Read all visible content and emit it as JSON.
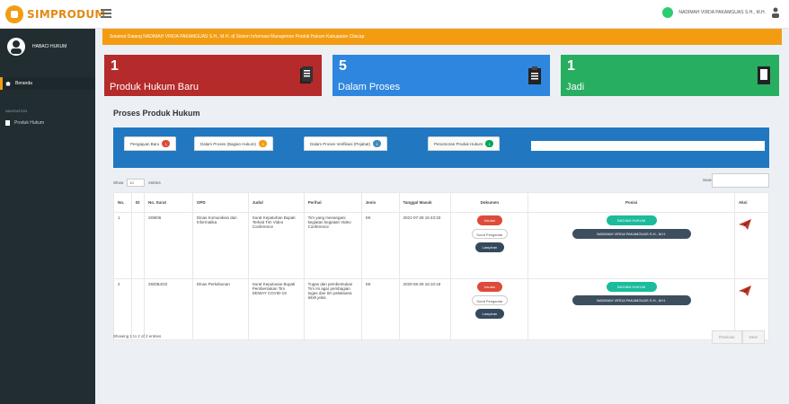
{
  "app": {
    "logo_text": "SIMPRODUM"
  },
  "header": {
    "user_name": "NADIMAH VIRDA PAKAMGUAS S.H., M.H."
  },
  "sidebar": {
    "user_label": "HABACI HUKUM",
    "items": [
      {
        "label": "Beranda",
        "active": true
      },
      {
        "label": "Produk Hukum",
        "active": false
      }
    ],
    "section_header": "NAVIGATION"
  },
  "alert": {
    "text": "Selamat Datang NADIMAH VIRDA PAKAMGUAS S.H., M.H. di Sistem Informasi Manajemen Produk Hukum Kabupaten Cilacap"
  },
  "stats": [
    {
      "count": "1",
      "label": "Produk Hukum Baru",
      "color": "#b52a2a"
    },
    {
      "count": "5",
      "label": "Dalam Proses",
      "color": "#2e86de"
    },
    {
      "count": "1",
      "label": "Jadi",
      "color": "#27ae60"
    }
  ],
  "panel": {
    "title": "Proses Produk Hukum"
  },
  "tabs": [
    {
      "label": "Pengajuan Baru",
      "badge": "1",
      "color": "red"
    },
    {
      "label": "Dalam Proses (Bagian Hukum)",
      "badge": "3",
      "color": "orange"
    },
    {
      "label": "Dalam Proses Verifikasi (Pejabat)",
      "badge": "1",
      "color": "blue"
    },
    {
      "label": "Penomoran Produk Hukum",
      "badge": "1",
      "color": "green"
    }
  ],
  "table_controls": {
    "show_label": "Show",
    "entries_value": "10",
    "entries_label": "entries",
    "search_label": "Search:"
  },
  "table": {
    "headers": [
      "No.",
      "ID",
      "No. Surat",
      "OPD",
      "Judul",
      "Perihal",
      "Jenis",
      "Tanggal Masuk",
      "Dokumen",
      "Posisi",
      "Aksi"
    ],
    "rows": [
      {
        "no": "1",
        "id": "",
        "no_surat": "S08/06",
        "opd": "Dinas Komunikasi dan Informatika",
        "judul": "Surat Kepatuhan Bupati Terkait Tim Video Conference",
        "perihal": "Tim yang menangani kegiatan kegiatan Video Conference",
        "jenis": "SK",
        "tanggal": "2021-07-28 15:43:33",
        "doc_buttons": [
          "Usulan",
          "Surat Pengantar",
          "Lampiran"
        ],
        "posisi": [
          "BAGIAN HUKUM",
          "NADIMAH VIRDA PAKAMGUAS S.H., M.H."
        ]
      },
      {
        "no": "2",
        "id": "",
        "no_surat": "25/DB4/22",
        "opd": "Dinas Perkebunan",
        "judul": "Surat Keputusan Bupati Pembentukan Tim DEWAY COVID-19",
        "perihal": "Tugas dan pembentukan Tim Ini agar pembagian tugas dan tim pelaksana lebih jelas",
        "jenis": "SK",
        "tanggal": "2020-06-29 16:10:18",
        "doc_buttons": [
          "Usulan",
          "Surat Pengantar",
          "Lampiran"
        ],
        "posisi": [
          "BAGIAN HUKUM",
          "NADIMAH VIRDA PAKAMGUAS S.H., M.H."
        ]
      }
    ]
  },
  "info": "Showing 1 to 2 of 2 entries",
  "pager": {
    "prev": "Previous",
    "next": "Next"
  }
}
